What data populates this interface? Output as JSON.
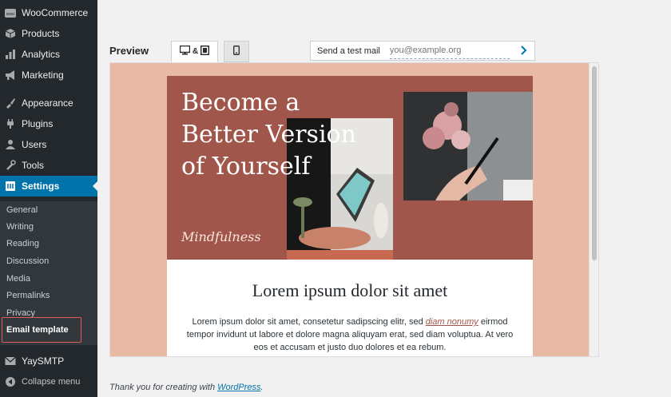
{
  "sidebar": {
    "items": [
      {
        "label": "WooCommerce",
        "icon": "woocommerce-icon"
      },
      {
        "label": "Products",
        "icon": "products-icon"
      },
      {
        "label": "Analytics",
        "icon": "analytics-icon"
      },
      {
        "label": "Marketing",
        "icon": "marketing-icon"
      },
      {
        "label": "Appearance",
        "icon": "appearance-icon"
      },
      {
        "label": "Plugins",
        "icon": "plugins-icon"
      },
      {
        "label": "Users",
        "icon": "users-icon"
      },
      {
        "label": "Tools",
        "icon": "tools-icon"
      },
      {
        "label": "Settings",
        "icon": "settings-icon"
      }
    ],
    "submenu": [
      "General",
      "Writing",
      "Reading",
      "Discussion",
      "Media",
      "Permalinks",
      "Privacy",
      "Email template"
    ],
    "bottom": [
      {
        "label": "YaySMTP",
        "icon": "yaysmtp-icon"
      },
      {
        "label": "Collapse menu",
        "icon": "collapse-icon"
      }
    ]
  },
  "header": {
    "preview_label": "Preview",
    "desktop_tab_label": "&",
    "test_mail_label": "Send a test mail",
    "test_mail_placeholder": "you@example.org"
  },
  "email": {
    "hero_title": "Become a\nBetter Version\nof Yourself",
    "hero_script": "Mindfulness",
    "heading": "Lorem ipsum dolor sit amet",
    "body_before_link": "Lorem ipsum dolor sit amet, consetetur sadipscing elitr, sed ",
    "body_link": "diam nonumy",
    "body_after_link": " eirmod tempor invidunt ut labore et dolore magna aliquyam erat, sed diam voluptua. At vero eos et accusam et justo duo dolores et ea rebum."
  },
  "footer": {
    "text_before": "Thank you for creating with ",
    "link": "WordPress",
    "text_after": "."
  },
  "colors": {
    "sidebar_bg": "#23282d",
    "submenu_bg": "#32373c",
    "active_bg": "#0073aa",
    "frame_bg": "#e8b9a4",
    "hero_bg": "#a0564a",
    "highlight_border": "#e25c5c"
  }
}
